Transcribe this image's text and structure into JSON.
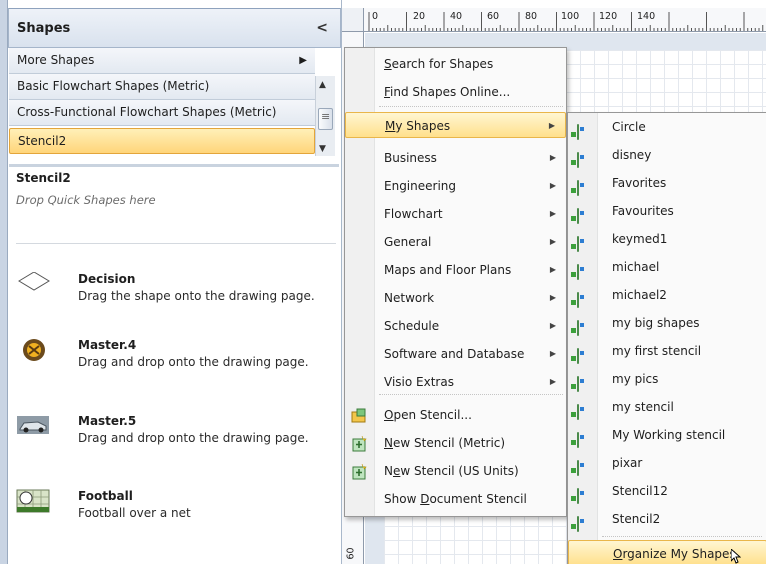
{
  "panel": {
    "title": "Shapes",
    "collapse_glyph": "<",
    "stencils": [
      {
        "label": "More Shapes",
        "has_arrow": true
      },
      {
        "label": "Basic Flowchart Shapes (Metric)"
      },
      {
        "label": "Cross-Functional Flowchart Shapes (Metric)"
      },
      {
        "label": "Stencil2",
        "selected": true
      }
    ],
    "quick_title": "Stencil2",
    "quick_hint": "Drop Quick Shapes here",
    "masters": [
      {
        "name": "Decision",
        "desc": "Drag the shape onto the drawing page.",
        "icon": "diamond-icon"
      },
      {
        "name": "Master.4",
        "desc": "Drag and drop onto the drawing page.",
        "icon": "ball-photo-icon"
      },
      {
        "name": "Master.5",
        "desc": "Drag and drop onto the drawing page.",
        "icon": "car-photo-icon"
      },
      {
        "name": "Football",
        "desc": "Football over a net",
        "icon": "football-net-icon"
      }
    ]
  },
  "ruler": {
    "h_labels": [
      "0",
      "20",
      "40",
      "60",
      "80",
      "100",
      "120",
      "140"
    ],
    "v_label": "60"
  },
  "menu_more_shapes": {
    "items": [
      {
        "pre": "",
        "u": "S",
        "post": "earch for Shapes"
      },
      {
        "pre": "",
        "u": "F",
        "post": "ind Shapes Online..."
      },
      {
        "pre": "",
        "u": "M",
        "post": "y Shapes",
        "has_arrow": true,
        "highlighted": true
      },
      {
        "pre": "Business",
        "u": "",
        "post": "",
        "has_arrow": true
      },
      {
        "pre": "Engineering",
        "u": "",
        "post": "",
        "has_arrow": true
      },
      {
        "pre": "Flowchart",
        "u": "",
        "post": "",
        "has_arrow": true
      },
      {
        "pre": "General",
        "u": "",
        "post": "",
        "has_arrow": true
      },
      {
        "pre": "Maps and Floor Plans",
        "u": "",
        "post": "",
        "has_arrow": true
      },
      {
        "pre": "Network",
        "u": "",
        "post": "",
        "has_arrow": true
      },
      {
        "pre": "Schedule",
        "u": "",
        "post": "",
        "has_arrow": true
      },
      {
        "pre": "Software and Database",
        "u": "",
        "post": "",
        "has_arrow": true
      },
      {
        "pre": "Visio Extras",
        "u": "",
        "post": "",
        "has_arrow": true
      },
      {
        "pre": "",
        "u": "O",
        "post": "pen Stencil...",
        "icon": "open-stencil-icon"
      },
      {
        "pre": "",
        "u": "N",
        "post": "ew Stencil (Metric)",
        "icon": "new-stencil-icon"
      },
      {
        "pre": "N",
        "u": "e",
        "post": "w Stencil (US Units)",
        "icon": "new-stencil-icon"
      },
      {
        "pre": "Show ",
        "u": "D",
        "post": "ocument Stencil"
      }
    ]
  },
  "menu_my_shapes": {
    "items": [
      "Circle",
      "disney",
      "Favorites",
      "Favourites",
      "keymed1",
      "michael",
      "michael2",
      "my big shapes",
      "my first stencil",
      "my pics",
      "my stencil",
      "My Working stencil",
      "pixar",
      "Stencil12",
      "Stencil2"
    ],
    "organize": {
      "pre": "",
      "u": "O",
      "post": "rganize My Shapes"
    },
    "item_icon": "stencil-file-icon"
  },
  "colors": {
    "highlight": "#ffe08c",
    "selection_border": "#e3a53a",
    "panel_header": "#d9e2ee"
  }
}
